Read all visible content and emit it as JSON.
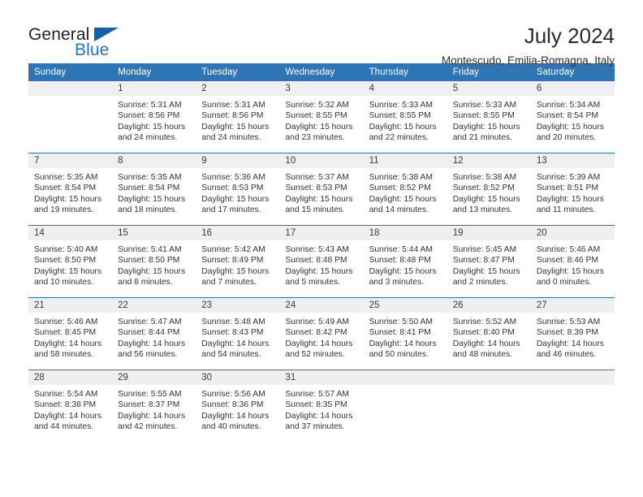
{
  "brand": {
    "name_part1": "General",
    "name_part2": "Blue",
    "triangle_color": "#1464a5",
    "blue_color": "#2176c7"
  },
  "header": {
    "title": "July 2024",
    "subtitle": "Montescudo, Emilia-Romagna, Italy"
  },
  "theme": {
    "header_bg": "#2e75b6",
    "daynum_bg": "#efefef",
    "rule_color": "#2e75b6",
    "text_color": "#333333"
  },
  "weekdays": [
    "Sunday",
    "Monday",
    "Tuesday",
    "Wednesday",
    "Thursday",
    "Friday",
    "Saturday"
  ],
  "weeks": [
    [
      {
        "day": "",
        "sunrise": "",
        "sunset": "",
        "daylight1": "",
        "daylight2": ""
      },
      {
        "day": "1",
        "sunrise": "Sunrise: 5:31 AM",
        "sunset": "Sunset: 8:56 PM",
        "daylight1": "Daylight: 15 hours",
        "daylight2": "and 24 minutes."
      },
      {
        "day": "2",
        "sunrise": "Sunrise: 5:31 AM",
        "sunset": "Sunset: 8:56 PM",
        "daylight1": "Daylight: 15 hours",
        "daylight2": "and 24 minutes."
      },
      {
        "day": "3",
        "sunrise": "Sunrise: 5:32 AM",
        "sunset": "Sunset: 8:55 PM",
        "daylight1": "Daylight: 15 hours",
        "daylight2": "and 23 minutes."
      },
      {
        "day": "4",
        "sunrise": "Sunrise: 5:33 AM",
        "sunset": "Sunset: 8:55 PM",
        "daylight1": "Daylight: 15 hours",
        "daylight2": "and 22 minutes."
      },
      {
        "day": "5",
        "sunrise": "Sunrise: 5:33 AM",
        "sunset": "Sunset: 8:55 PM",
        "daylight1": "Daylight: 15 hours",
        "daylight2": "and 21 minutes."
      },
      {
        "day": "6",
        "sunrise": "Sunrise: 5:34 AM",
        "sunset": "Sunset: 8:54 PM",
        "daylight1": "Daylight: 15 hours",
        "daylight2": "and 20 minutes."
      }
    ],
    [
      {
        "day": "7",
        "sunrise": "Sunrise: 5:35 AM",
        "sunset": "Sunset: 8:54 PM",
        "daylight1": "Daylight: 15 hours",
        "daylight2": "and 19 minutes."
      },
      {
        "day": "8",
        "sunrise": "Sunrise: 5:35 AM",
        "sunset": "Sunset: 8:54 PM",
        "daylight1": "Daylight: 15 hours",
        "daylight2": "and 18 minutes."
      },
      {
        "day": "9",
        "sunrise": "Sunrise: 5:36 AM",
        "sunset": "Sunset: 8:53 PM",
        "daylight1": "Daylight: 15 hours",
        "daylight2": "and 17 minutes."
      },
      {
        "day": "10",
        "sunrise": "Sunrise: 5:37 AM",
        "sunset": "Sunset: 8:53 PM",
        "daylight1": "Daylight: 15 hours",
        "daylight2": "and 15 minutes."
      },
      {
        "day": "11",
        "sunrise": "Sunrise: 5:38 AM",
        "sunset": "Sunset: 8:52 PM",
        "daylight1": "Daylight: 15 hours",
        "daylight2": "and 14 minutes."
      },
      {
        "day": "12",
        "sunrise": "Sunrise: 5:38 AM",
        "sunset": "Sunset: 8:52 PM",
        "daylight1": "Daylight: 15 hours",
        "daylight2": "and 13 minutes."
      },
      {
        "day": "13",
        "sunrise": "Sunrise: 5:39 AM",
        "sunset": "Sunset: 8:51 PM",
        "daylight1": "Daylight: 15 hours",
        "daylight2": "and 11 minutes."
      }
    ],
    [
      {
        "day": "14",
        "sunrise": "Sunrise: 5:40 AM",
        "sunset": "Sunset: 8:50 PM",
        "daylight1": "Daylight: 15 hours",
        "daylight2": "and 10 minutes."
      },
      {
        "day": "15",
        "sunrise": "Sunrise: 5:41 AM",
        "sunset": "Sunset: 8:50 PM",
        "daylight1": "Daylight: 15 hours",
        "daylight2": "and 8 minutes."
      },
      {
        "day": "16",
        "sunrise": "Sunrise: 5:42 AM",
        "sunset": "Sunset: 8:49 PM",
        "daylight1": "Daylight: 15 hours",
        "daylight2": "and 7 minutes."
      },
      {
        "day": "17",
        "sunrise": "Sunrise: 5:43 AM",
        "sunset": "Sunset: 8:48 PM",
        "daylight1": "Daylight: 15 hours",
        "daylight2": "and 5 minutes."
      },
      {
        "day": "18",
        "sunrise": "Sunrise: 5:44 AM",
        "sunset": "Sunset: 8:48 PM",
        "daylight1": "Daylight: 15 hours",
        "daylight2": "and 3 minutes."
      },
      {
        "day": "19",
        "sunrise": "Sunrise: 5:45 AM",
        "sunset": "Sunset: 8:47 PM",
        "daylight1": "Daylight: 15 hours",
        "daylight2": "and 2 minutes."
      },
      {
        "day": "20",
        "sunrise": "Sunrise: 5:46 AM",
        "sunset": "Sunset: 8:46 PM",
        "daylight1": "Daylight: 15 hours",
        "daylight2": "and 0 minutes."
      }
    ],
    [
      {
        "day": "21",
        "sunrise": "Sunrise: 5:46 AM",
        "sunset": "Sunset: 8:45 PM",
        "daylight1": "Daylight: 14 hours",
        "daylight2": "and 58 minutes."
      },
      {
        "day": "22",
        "sunrise": "Sunrise: 5:47 AM",
        "sunset": "Sunset: 8:44 PM",
        "daylight1": "Daylight: 14 hours",
        "daylight2": "and 56 minutes."
      },
      {
        "day": "23",
        "sunrise": "Sunrise: 5:48 AM",
        "sunset": "Sunset: 8:43 PM",
        "daylight1": "Daylight: 14 hours",
        "daylight2": "and 54 minutes."
      },
      {
        "day": "24",
        "sunrise": "Sunrise: 5:49 AM",
        "sunset": "Sunset: 8:42 PM",
        "daylight1": "Daylight: 14 hours",
        "daylight2": "and 52 minutes."
      },
      {
        "day": "25",
        "sunrise": "Sunrise: 5:50 AM",
        "sunset": "Sunset: 8:41 PM",
        "daylight1": "Daylight: 14 hours",
        "daylight2": "and 50 minutes."
      },
      {
        "day": "26",
        "sunrise": "Sunrise: 5:52 AM",
        "sunset": "Sunset: 8:40 PM",
        "daylight1": "Daylight: 14 hours",
        "daylight2": "and 48 minutes."
      },
      {
        "day": "27",
        "sunrise": "Sunrise: 5:53 AM",
        "sunset": "Sunset: 8:39 PM",
        "daylight1": "Daylight: 14 hours",
        "daylight2": "and 46 minutes."
      }
    ],
    [
      {
        "day": "28",
        "sunrise": "Sunrise: 5:54 AM",
        "sunset": "Sunset: 8:38 PM",
        "daylight1": "Daylight: 14 hours",
        "daylight2": "and 44 minutes."
      },
      {
        "day": "29",
        "sunrise": "Sunrise: 5:55 AM",
        "sunset": "Sunset: 8:37 PM",
        "daylight1": "Daylight: 14 hours",
        "daylight2": "and 42 minutes."
      },
      {
        "day": "30",
        "sunrise": "Sunrise: 5:56 AM",
        "sunset": "Sunset: 8:36 PM",
        "daylight1": "Daylight: 14 hours",
        "daylight2": "and 40 minutes."
      },
      {
        "day": "31",
        "sunrise": "Sunrise: 5:57 AM",
        "sunset": "Sunset: 8:35 PM",
        "daylight1": "Daylight: 14 hours",
        "daylight2": "and 37 minutes."
      },
      {
        "day": "",
        "sunrise": "",
        "sunset": "",
        "daylight1": "",
        "daylight2": ""
      },
      {
        "day": "",
        "sunrise": "",
        "sunset": "",
        "daylight1": "",
        "daylight2": ""
      },
      {
        "day": "",
        "sunrise": "",
        "sunset": "",
        "daylight1": "",
        "daylight2": ""
      }
    ]
  ]
}
